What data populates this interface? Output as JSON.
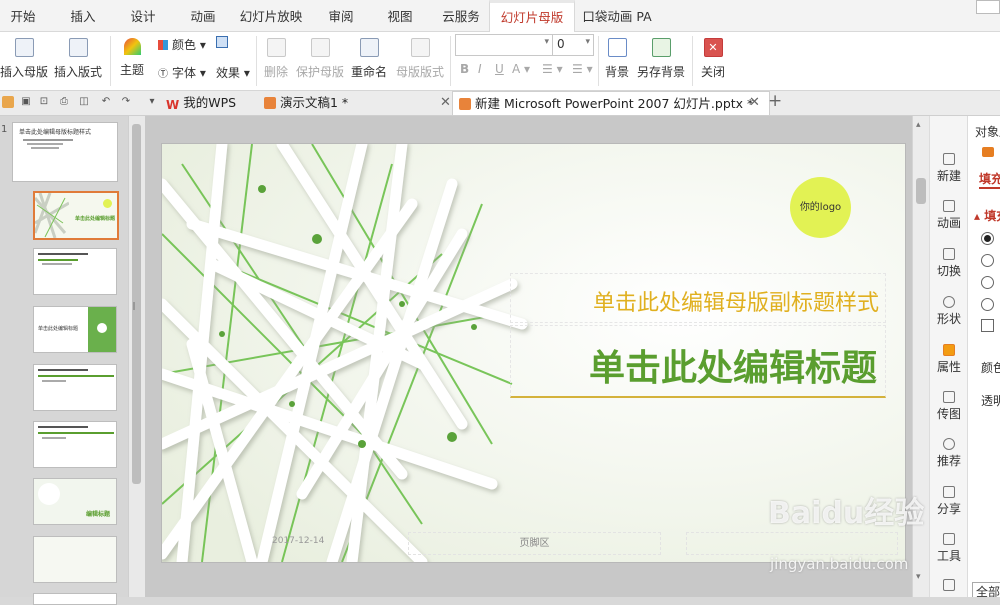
{
  "menu": {
    "tabs": [
      "开始",
      "插入",
      "设计",
      "动画",
      "幻灯片放映",
      "审阅",
      "视图",
      "云服务",
      "幻灯片母版",
      "口袋动画 PA"
    ],
    "active_tab": "幻灯片母版"
  },
  "ribbon": {
    "insert_master": "插入母版",
    "insert_layout": "插入版式",
    "theme": "主题",
    "colors": "颜色",
    "fonts": "字体",
    "effects": "效果",
    "delete": "删除",
    "protect_master": "保护母版",
    "rename": "重命名",
    "master_layout": "母版版式",
    "font_size_value": "0",
    "bold": "B",
    "italic": "I",
    "underline": "U",
    "font_color": "A",
    "background": "背景",
    "save_background": "另存背景",
    "close": "关闭"
  },
  "doc_tabs": {
    "tab1": "我的WPS",
    "tab2": "演示文稿1 *",
    "tab3": "新建 Microsoft PowerPoint 2007 幻灯片.pptx *",
    "add": "+"
  },
  "thumbs": {
    "master_number": "1",
    "master_title": "单击此处编辑母版标题样式",
    "layout2_text": "单击此处编辑标题",
    "layout4_text": "单击此处编辑标题",
    "layout8_text": "编辑标题"
  },
  "slide": {
    "logo_text": "你的logo",
    "subtitle": "单击此处编辑母版副标题样式",
    "title": "单击此处编辑标题",
    "date": "2017-12-14",
    "footer": "页脚区",
    "subtitle_color": "#e0b020",
    "title_color": "#5a9e2f",
    "logo_color": "#e2f254"
  },
  "sidebar": {
    "items": [
      "新建",
      "动画",
      "切换",
      "形状",
      "属性",
      "传图",
      "推荐",
      "分享",
      "工具"
    ]
  },
  "props": {
    "header": "对象属",
    "fill_tab": "填充",
    "fill_section": "填充",
    "color_label": "颜色",
    "transparency_label": "透明",
    "apply_all": "全部"
  },
  "watermark": {
    "brand": "Baidu经验",
    "url": "jingyan.baidu.com"
  }
}
